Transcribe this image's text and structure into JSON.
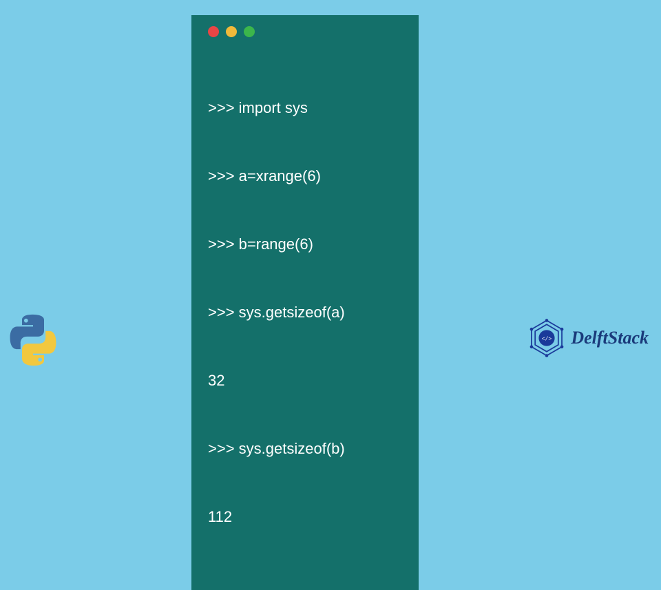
{
  "terminal": {
    "lines": [
      ">>> import sys",
      ">>> a=xrange(6)",
      ">>> b=range(6)",
      ">>> sys.getsizeof(a)",
      "32",
      ">>> sys.getsizeof(b)",
      "112"
    ]
  },
  "brand": {
    "name": "DelftStack"
  },
  "icons": {
    "python": "python-logo",
    "delft_badge": "delftstack-badge"
  }
}
